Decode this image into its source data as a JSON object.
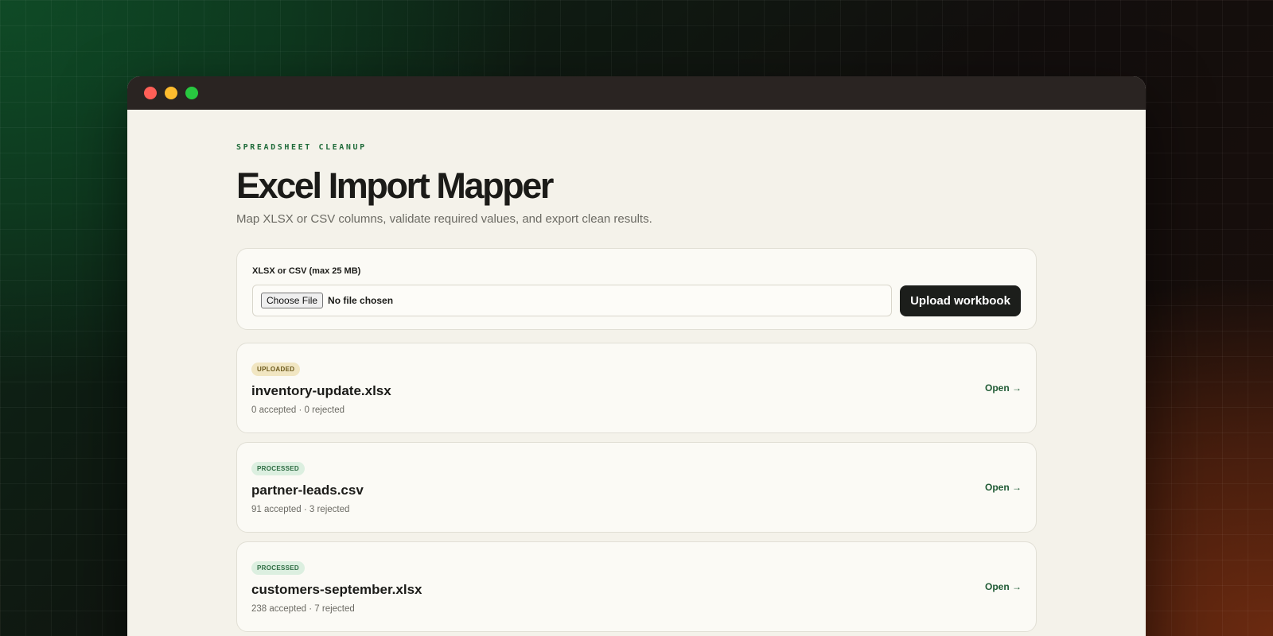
{
  "window": {
    "controls": [
      "close",
      "minimize",
      "zoom"
    ]
  },
  "header": {
    "eyebrow": "SPREADSHEET CLEANUP",
    "title": "Excel Import Mapper",
    "subtitle": "Map XLSX or CSV columns, validate required values, and export clean results."
  },
  "upload": {
    "label": "XLSX or CSV (max 25 MB)",
    "choose_button": "Choose File",
    "file_status": "No file chosen",
    "submit_label": "Upload workbook"
  },
  "imports": [
    {
      "status": "UPLOADED",
      "status_color": "#f1e6c2",
      "file_name": "inventory-update.xlsx",
      "summary": "0 accepted · 0 rejected",
      "action": "Open →"
    },
    {
      "status": "PROCESSED",
      "status_color": "#dcefe0",
      "file_name": "partner-leads.csv",
      "summary": "91 accepted · 3 rejected",
      "action": "Open →"
    },
    {
      "status": "PROCESSED",
      "status_color": "#dcefe0",
      "file_name": "customers-september.xlsx",
      "summary": "238 accepted · 7 rejected",
      "action": "Open →"
    }
  ]
}
